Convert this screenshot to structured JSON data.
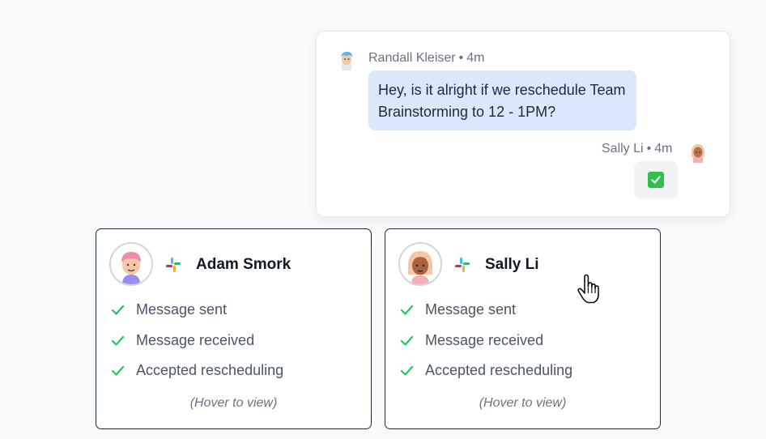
{
  "chat": {
    "sender": "Randall Kleiser",
    "sender_time": "4m",
    "separator": "•",
    "message": "Hey, is it alright if we reschedule Team Brainstorming to 12 - 1PM?",
    "reply_author": "Sally Li",
    "reply_time": "4m",
    "reaction_icon": "white-check-mark-icon"
  },
  "participants": [
    {
      "name": "Adam Smork",
      "platform_icon": "slack-icon",
      "steps": [
        "Message sent",
        "Message received",
        "Accepted rescheduling"
      ],
      "hint": "(Hover to view)"
    },
    {
      "name": "Sally Li",
      "platform_icon": "slack-icon",
      "steps": [
        "Message sent",
        "Message received",
        "Accepted rescheduling"
      ],
      "hint": "(Hover to view)"
    }
  ],
  "colors": {
    "bubble": "#dbe7fb",
    "check": "#22c55e",
    "card_border": "#1f2937"
  }
}
